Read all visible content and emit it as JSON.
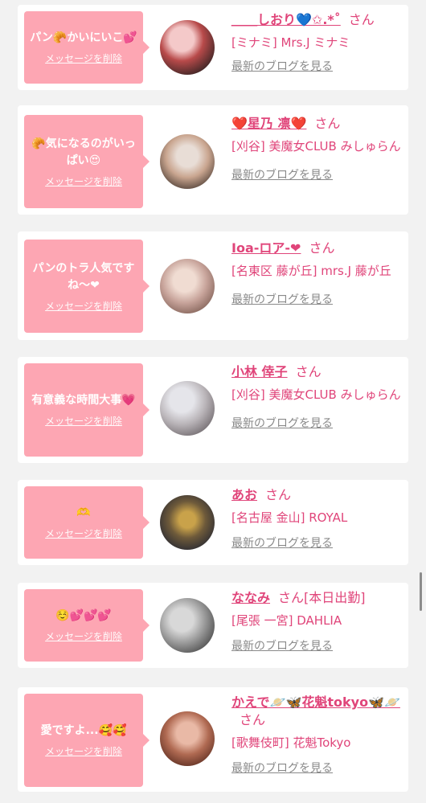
{
  "items": [
    {
      "message": "パン🥐かいにいこ💕",
      "delete_label": "メッセージを削除",
      "name": "＿＿しおり💙✩.*˚",
      "suffix": "さん",
      "shop": "[ミナミ] Mrs.J ミナミ",
      "blog_label": "最新のブログを見る",
      "avatar_colors": [
        "#f4c9c9",
        "#b84a4a",
        "#3b2525"
      ]
    },
    {
      "message": "🥐気になるのがいっぱい😍",
      "delete_label": "メッセージを削除",
      "name": "❤️星乃 凛❤️",
      "suffix": "さん",
      "shop": "[刈谷] 美魔女CLUB みしゅらん",
      "blog_label": "最新のブログを見る",
      "avatar_colors": [
        "#e8ddd6",
        "#c9a58f",
        "#4a3b33"
      ]
    },
    {
      "message": "パンのトラ人気ですね〜❤",
      "delete_label": "メッセージを削除",
      "name": "Ioa-ロア-❤",
      "suffix": "さん",
      "shop": "[名東区 藤が丘] mrs.J 藤が丘",
      "blog_label": "最新のブログを見る",
      "avatar_colors": [
        "#f0dcd2",
        "#c7a39a",
        "#7a5a50"
      ]
    },
    {
      "message": "有意義な時間大事💗",
      "delete_label": "メッセージを削除",
      "name": "小林 倖子",
      "suffix": "さん",
      "shop": "[刈谷] 美魔女CLUB みしゅらん",
      "blog_label": "最新のブログを見る",
      "avatar_colors": [
        "#e5e5ea",
        "#b9b4b8",
        "#6b6468"
      ]
    },
    {
      "message": "🫶",
      "delete_label": "メッセージを削除",
      "name": "あお",
      "suffix": "さん",
      "shop": "[名古屋 金山] ROYAL",
      "blog_label": "最新のブログを見る",
      "avatar_colors": [
        "#2b2b33",
        "#c9a24a",
        "#6e5a3a"
      ]
    },
    {
      "message": "☺️💕💕💕",
      "delete_label": "メッセージを削除",
      "name": "ななみ",
      "suffix": "さん[本日出勤]",
      "shop": "[尾張 一宮] DAHLIA",
      "blog_label": "最新のブログを見る",
      "avatar_colors": [
        "#d8d8d8",
        "#9a9a9a",
        "#444444"
      ]
    },
    {
      "message": "愛ですよ...🥰🥰",
      "delete_label": "メッセージを削除",
      "name": "かえで🪐🦋花魁tokyo🦋🪐",
      "suffix": "さん",
      "shop": "[歌舞伎町] 花魁Tokyo",
      "blog_label": "最新のブログを見る",
      "avatar_colors": [
        "#e9b9a6",
        "#b06a52",
        "#5a2c20"
      ]
    }
  ]
}
